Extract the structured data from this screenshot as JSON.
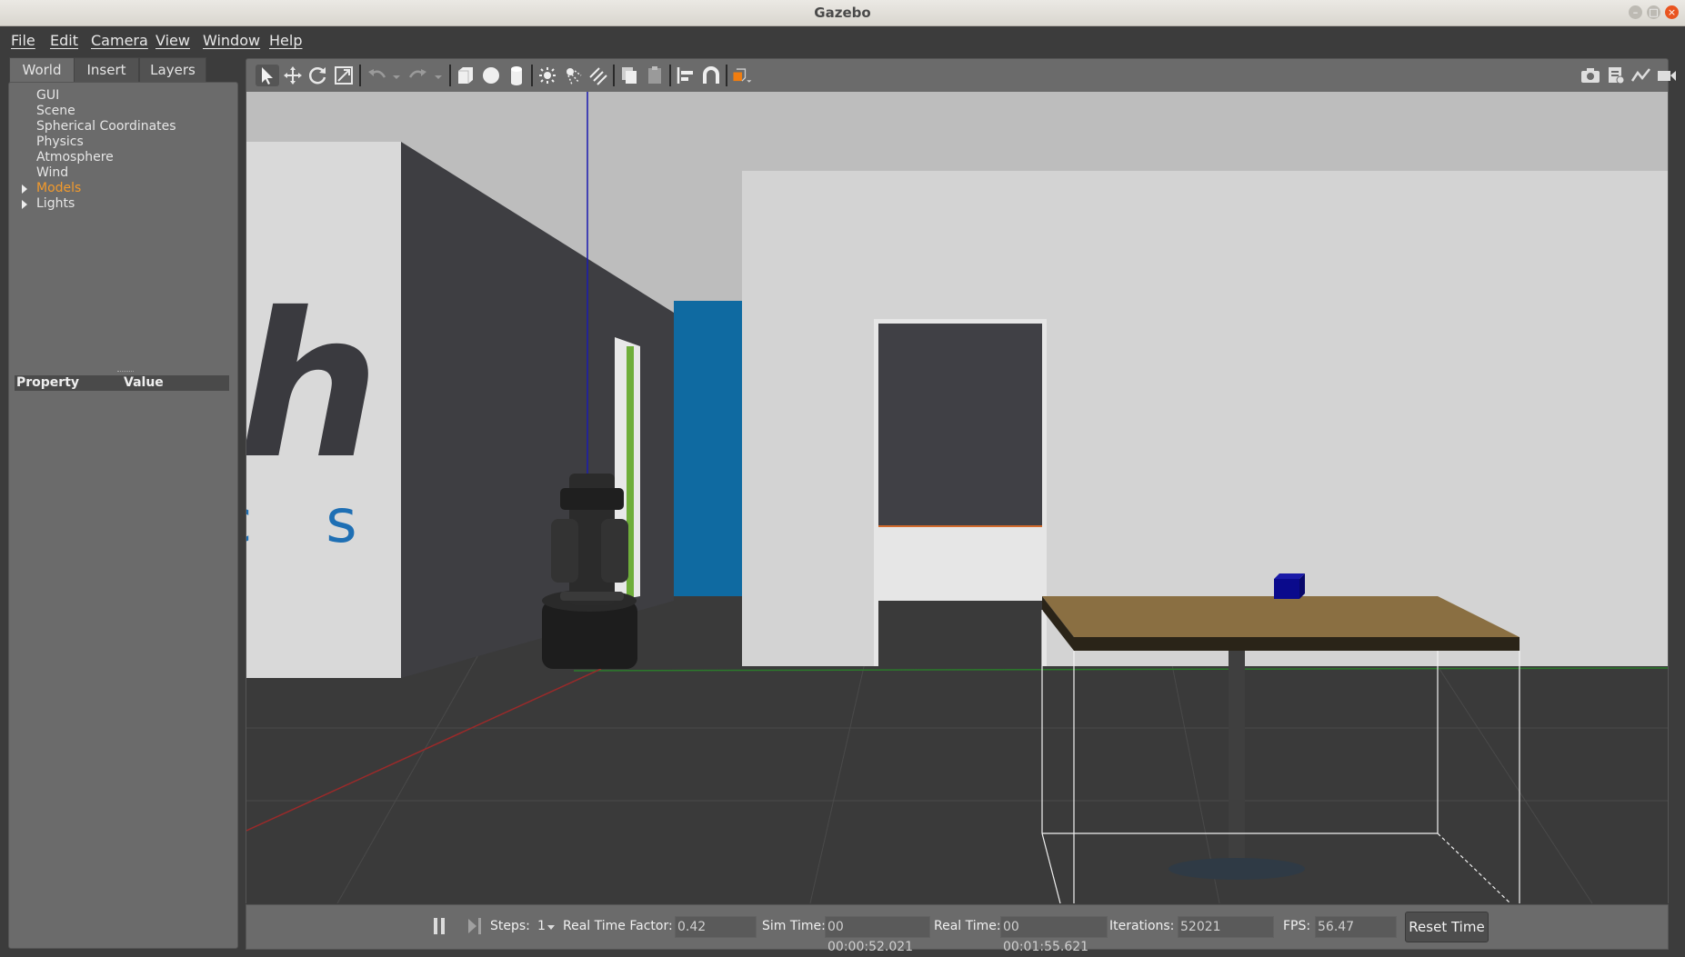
{
  "window": {
    "title": "Gazebo"
  },
  "menu": [
    "File",
    "Edit",
    "Camera",
    "View",
    "Window",
    "Help"
  ],
  "tabs": [
    "World",
    "Insert",
    "Layers"
  ],
  "tree": [
    {
      "label": "GUI",
      "expandable": false,
      "selected": false
    },
    {
      "label": "Scene",
      "expandable": false,
      "selected": false
    },
    {
      "label": "Spherical Coordinates",
      "expandable": false,
      "selected": false
    },
    {
      "label": "Physics",
      "expandable": false,
      "selected": false
    },
    {
      "label": "Atmosphere",
      "expandable": false,
      "selected": false
    },
    {
      "label": "Wind",
      "expandable": false,
      "selected": false
    },
    {
      "label": "Models",
      "expandable": true,
      "selected": true
    },
    {
      "label": "Lights",
      "expandable": true,
      "selected": false
    }
  ],
  "properties": {
    "col_property": "Property",
    "col_value": "Value"
  },
  "scene": {
    "wall_text_big": "h",
    "wall_text_small": "c s"
  },
  "statusbar": {
    "steps_label": "Steps:",
    "steps_value": "1",
    "rtf_label": "Real Time Factor:",
    "rtf_value": "0.42",
    "simtime_label": "Sim Time:",
    "simtime_value": "00 00:00:52.021",
    "realtime_label": "Real Time:",
    "realtime_value": "00 00:01:55.621",
    "iterations_label": "Iterations:",
    "iterations_value": "52021",
    "fps_label": "FPS:",
    "fps_value": "56.47",
    "reset_label": "Reset Time"
  },
  "colors": {
    "accent": "#f29a2c",
    "close": "#e95420",
    "panel": "#6b6b6b",
    "dark": "#3c3c3c"
  }
}
